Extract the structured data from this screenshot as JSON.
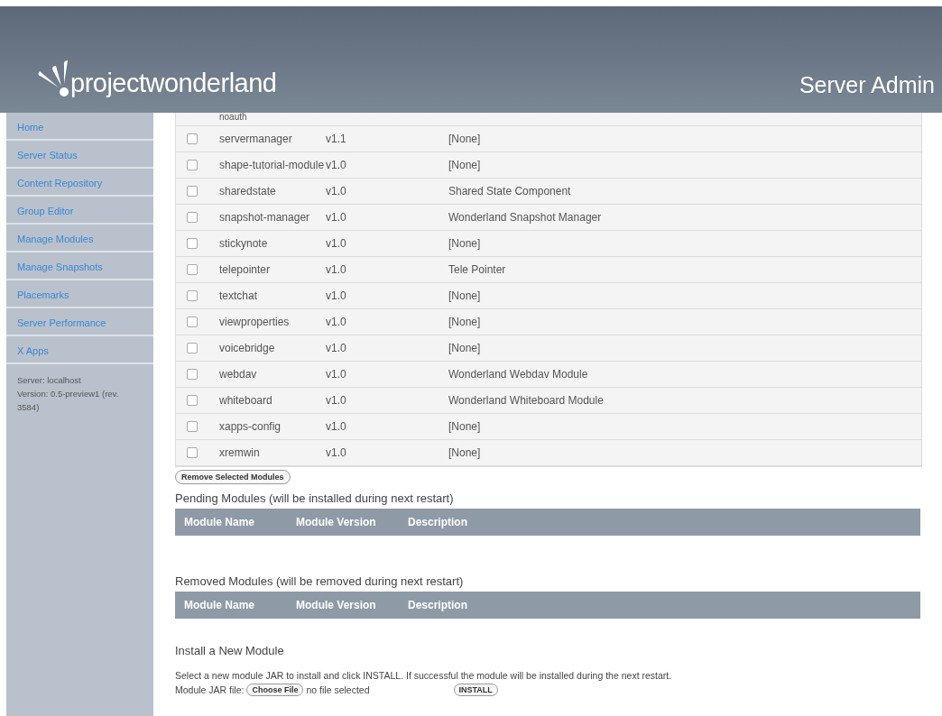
{
  "header": {
    "logo_text": "projectwonderland",
    "title": "Server Admin"
  },
  "sidebar": {
    "items": [
      {
        "label": "Home"
      },
      {
        "label": "Server Status"
      },
      {
        "label": "Content Repository"
      },
      {
        "label": "Group Editor"
      },
      {
        "label": "Manage Modules"
      },
      {
        "label": "Manage Snapshots"
      },
      {
        "label": "Placemarks"
      },
      {
        "label": "Server Performance"
      },
      {
        "label": "X Apps"
      }
    ],
    "info": [
      "Server: localhost",
      "Version: 0.5-preview1 (rev. 3584)"
    ]
  },
  "modules": {
    "rows": [
      {
        "name": "noauth"
      },
      {
        "name": "servermanager",
        "version": "v1.1",
        "description": "[None]",
        "checked": false
      },
      {
        "name": "shape-tutorial-module",
        "version": "v1.0",
        "description": "[None]",
        "checked": false
      },
      {
        "name": "sharedstate",
        "version": "v1.0",
        "description": "Shared State Component",
        "checked": false
      },
      {
        "name": "snapshot-manager",
        "version": "v1.0",
        "description": "Wonderland Snapshot Manager",
        "checked": false
      },
      {
        "name": "stickynote",
        "version": "v1.0",
        "description": "[None]",
        "checked": false
      },
      {
        "name": "telepointer",
        "version": "v1.0",
        "description": "Tele Pointer",
        "checked": false
      },
      {
        "name": "textchat",
        "version": "v1.0",
        "description": "[None]",
        "checked": false
      },
      {
        "name": "viewproperties",
        "version": "v1.0",
        "description": "[None]",
        "checked": false
      },
      {
        "name": "voicebridge",
        "version": "v1.0",
        "description": "[None]",
        "checked": false
      },
      {
        "name": "webdav",
        "version": "v1.0",
        "description": "Wonderland Webdav Module",
        "checked": false
      },
      {
        "name": "whiteboard",
        "version": "v1.0",
        "description": "Wonderland Whiteboard Module",
        "checked": false
      },
      {
        "name": "xapps-config",
        "version": "v1.0",
        "description": "[None]",
        "checked": false
      },
      {
        "name": "xremwin",
        "version": "v1.0",
        "description": "[None]",
        "checked": false
      }
    ],
    "remove_button": "Remove Selected Modules"
  },
  "pending": {
    "title": "Pending Modules (will be installed during next restart)",
    "columns": [
      "Module Name",
      "Module Version",
      "Description"
    ]
  },
  "removed": {
    "title": "Removed Modules (will be removed during next restart)",
    "columns": [
      "Module Name",
      "Module Version",
      "Description"
    ]
  },
  "install": {
    "title": "Install a New Module",
    "instructions": "Select a new module JAR to install and click INSTALL. If successful the module will be installed during the next restart.",
    "file_label": "Module JAR file:",
    "choose_button": "Choose File",
    "file_status": "no file selected",
    "install_button": "INSTALL"
  }
}
